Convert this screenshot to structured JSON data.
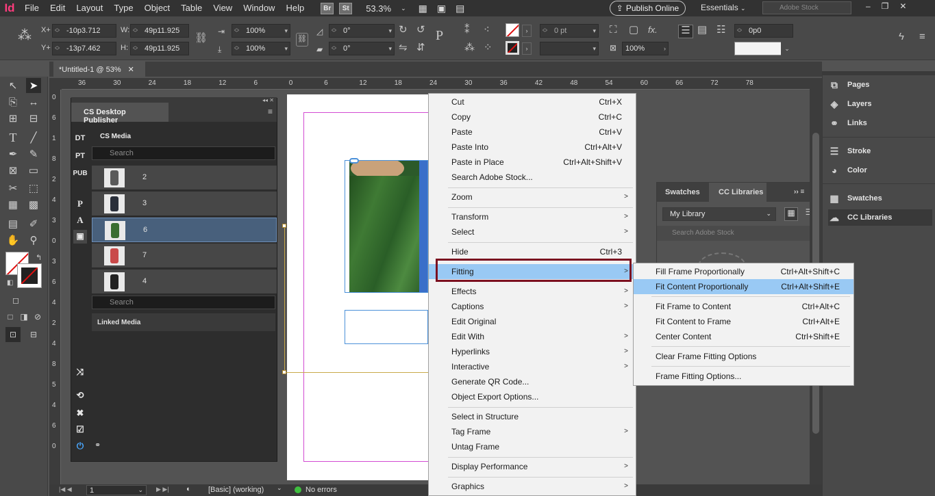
{
  "app": {
    "logo": "Id",
    "menus": [
      "File",
      "Edit",
      "Layout",
      "Type",
      "Object",
      "Table",
      "View",
      "Window",
      "Help"
    ],
    "badges": [
      "Br",
      "St"
    ],
    "zoom": "53.3%",
    "publish": "Publish Online",
    "workspace": "Essentials",
    "stock_placeholder": "Adobe Stock"
  },
  "control": {
    "x_label": "X+",
    "y_label": "Y+",
    "x": "-10p3.712",
    "y": "-13p7.462",
    "w_label": "W:",
    "h_label": "H:",
    "w": "49p11.925",
    "h": "49p11.925",
    "scale_x": "100%",
    "scale_y": "100%",
    "rotate": "0°",
    "shear": "0°",
    "stroke": "0 pt",
    "opacity": "100%",
    "offset": "0p0"
  },
  "doc_tab": {
    "title": "*Untitled-1 @ 53%"
  },
  "ruler": {
    "h_ticks": [
      "36",
      "30",
      "24",
      "18",
      "12",
      "6",
      "0",
      "6",
      "12",
      "18",
      "24",
      "30",
      "36",
      "42",
      "48",
      "54",
      "60",
      "66",
      "72",
      "78"
    ],
    "v_ticks": [
      "0",
      "6",
      "1",
      "8",
      "2",
      "4",
      "3",
      "0",
      "3",
      "6",
      "4",
      "2",
      "4",
      "8",
      "5",
      "4",
      "6",
      "0"
    ]
  },
  "cs_panel": {
    "title": "CS Desktop Publisher",
    "side": [
      "DT",
      "PT",
      "PUB"
    ],
    "side2": [
      "P",
      "A"
    ],
    "section": "CS Media",
    "search": "Search",
    "items": [
      "2",
      "3",
      "6",
      "7",
      "4"
    ],
    "search2": "Search",
    "linked": "Linked Media"
  },
  "context_menu": {
    "items": [
      {
        "label": "Cut",
        "shortcut": "Ctrl+X"
      },
      {
        "label": "Copy",
        "shortcut": "Ctrl+C"
      },
      {
        "label": "Paste",
        "shortcut": "Ctrl+V"
      },
      {
        "label": "Paste Into",
        "shortcut": "Ctrl+Alt+V"
      },
      {
        "label": "Paste in Place",
        "shortcut": "Ctrl+Alt+Shift+V"
      },
      {
        "label": "Search Adobe Stock...",
        "shortcut": ""
      },
      {
        "label": "Zoom",
        "shortcut": ""
      },
      {
        "label": "Transform",
        "shortcut": ""
      },
      {
        "label": "Select",
        "shortcut": ""
      },
      {
        "label": "Hide",
        "shortcut": "Ctrl+3"
      },
      {
        "label": "Fitting",
        "shortcut": ""
      },
      {
        "label": "Effects",
        "shortcut": ""
      },
      {
        "label": "Captions",
        "shortcut": ""
      },
      {
        "label": "Edit Original",
        "shortcut": ""
      },
      {
        "label": "Edit With",
        "shortcut": ""
      },
      {
        "label": "Hyperlinks",
        "shortcut": ""
      },
      {
        "label": "Interactive",
        "shortcut": ""
      },
      {
        "label": "Generate QR Code...",
        "shortcut": ""
      },
      {
        "label": "Object Export Options...",
        "shortcut": ""
      },
      {
        "label": "Select in Structure",
        "shortcut": ""
      },
      {
        "label": "Tag Frame",
        "shortcut": ""
      },
      {
        "label": "Untag Frame",
        "shortcut": ""
      },
      {
        "label": "Display Performance",
        "shortcut": ""
      },
      {
        "label": "Graphics",
        "shortcut": ""
      }
    ]
  },
  "fitting_menu": {
    "items": [
      {
        "label": "Fill Frame Proportionally",
        "shortcut": "Ctrl+Alt+Shift+C"
      },
      {
        "label": "Fit Content Proportionally",
        "shortcut": "Ctrl+Alt+Shift+E"
      },
      {
        "label": "Fit Frame to Content",
        "shortcut": "Ctrl+Alt+C"
      },
      {
        "label": "Fit Content to Frame",
        "shortcut": "Ctrl+Alt+E"
      },
      {
        "label": "Center Content",
        "shortcut": "Ctrl+Shift+E"
      },
      {
        "label": "Clear Frame Fitting Options",
        "shortcut": ""
      },
      {
        "label": "Frame Fitting Options...",
        "shortcut": ""
      }
    ]
  },
  "libraries": {
    "tab1": "Swatches",
    "tab2": "CC Libraries",
    "library": "My Library",
    "search": "Search Adobe Stock"
  },
  "dock": {
    "items": [
      "Pages",
      "Layers",
      "Links",
      "Stroke",
      "Color",
      "Swatches",
      "CC Libraries"
    ]
  },
  "status": {
    "page": "1",
    "style": "[Basic] (working)",
    "errors": "No errors"
  },
  "colors": {
    "accent_menu_highlight": "#99c9f4",
    "fitting_outline": "#7b1020",
    "logo": "#ff3c7d",
    "selection_frame": "#4a90d9"
  }
}
